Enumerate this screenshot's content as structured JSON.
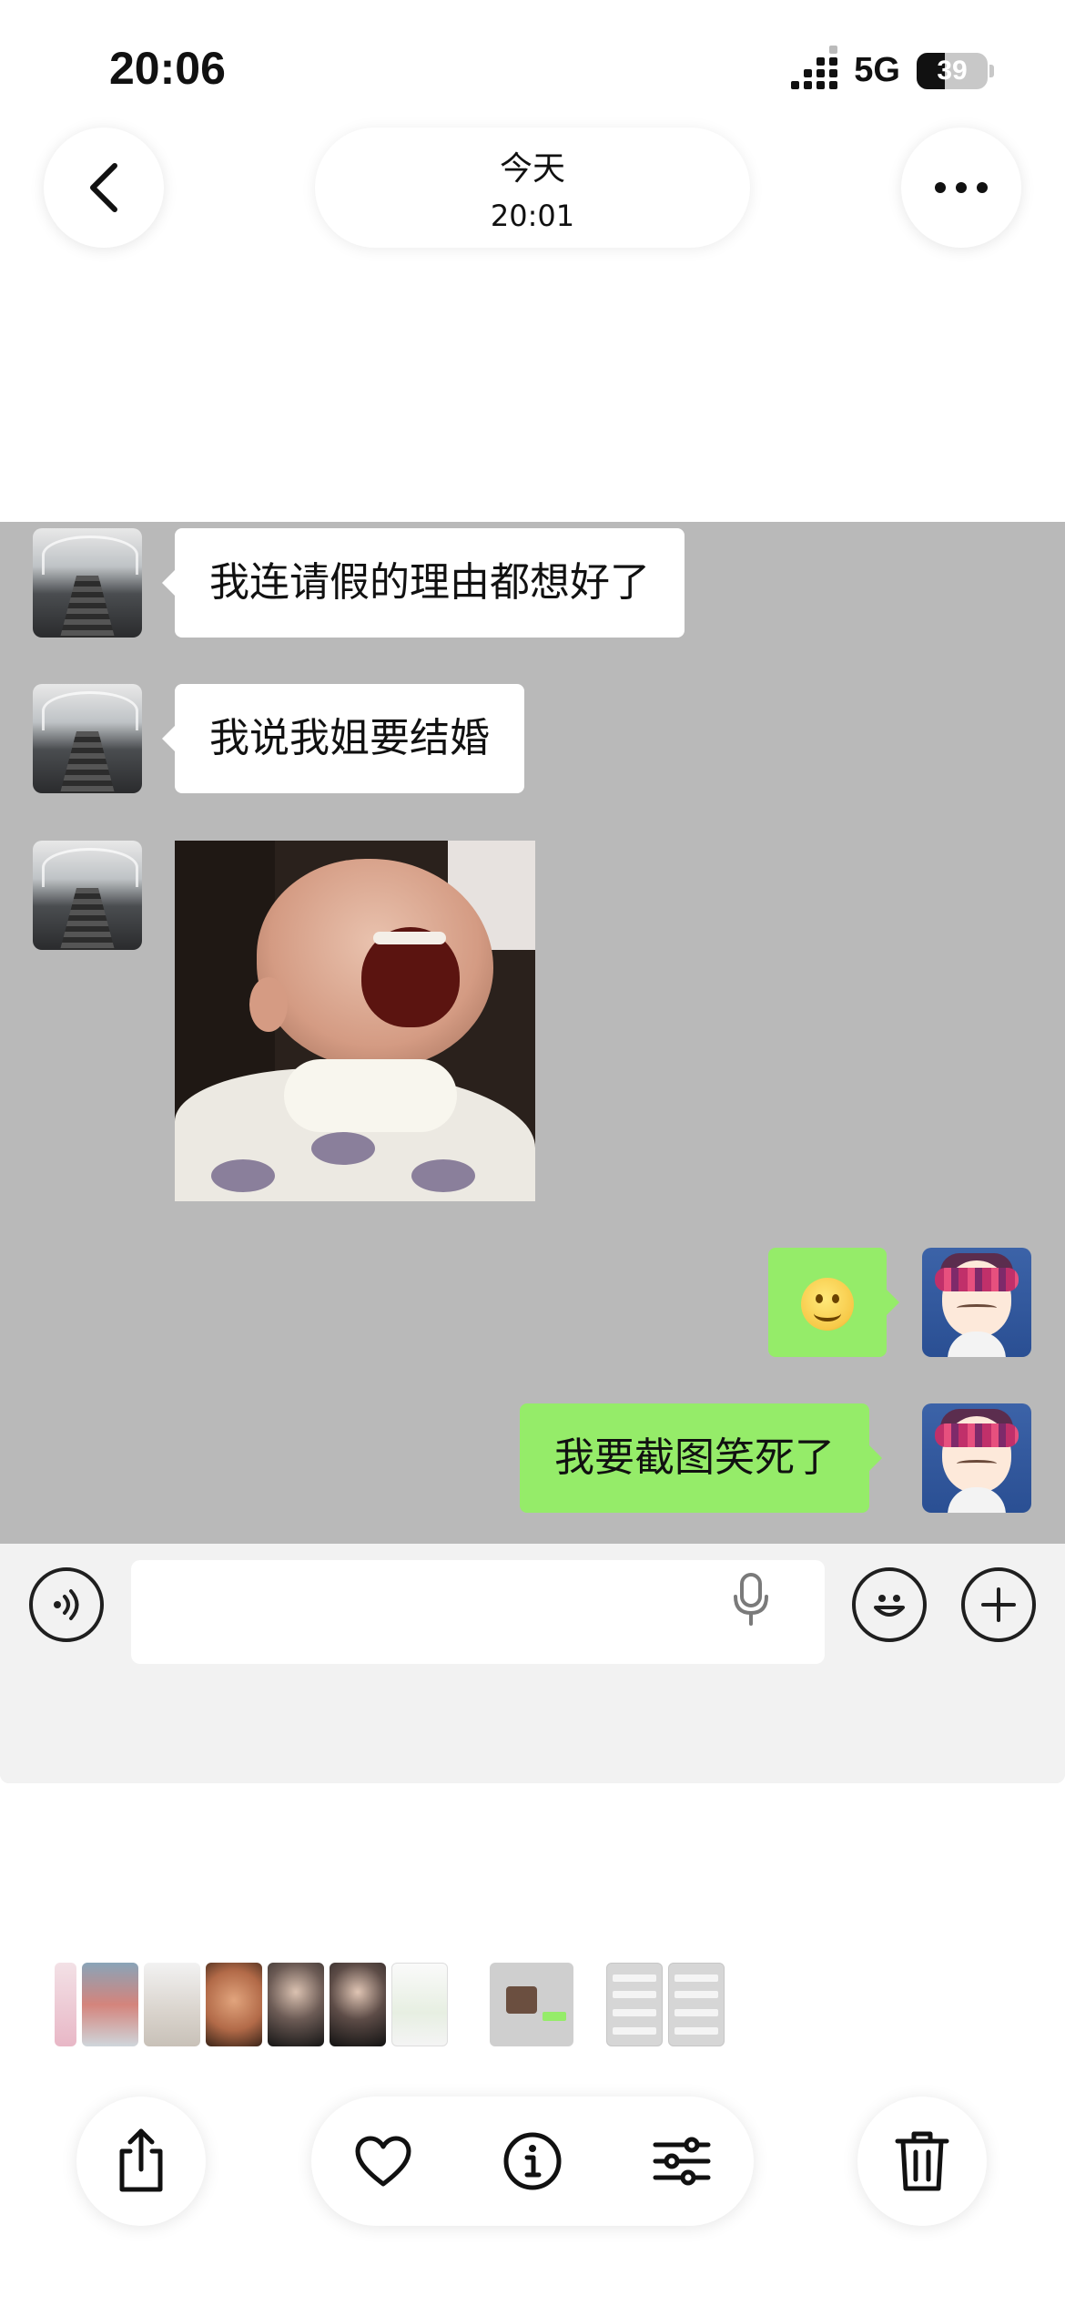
{
  "status_bar": {
    "time": "20:06",
    "network": "5G",
    "battery": "39"
  },
  "header": {
    "date_label": "今天",
    "time_label": "20:01"
  },
  "chat": {
    "messages": [
      {
        "side": "left",
        "type": "text",
        "text": "我连请假的理由都想好了"
      },
      {
        "side": "left",
        "type": "text",
        "text": "我说我姐要结婚"
      },
      {
        "side": "left",
        "type": "image"
      },
      {
        "side": "right",
        "type": "emoji",
        "emoji": "smiling-face"
      },
      {
        "side": "right",
        "type": "text",
        "text": "我要截图笑死了"
      }
    ]
  },
  "input_bar": {
    "voice_icon": "voice-wave-icon",
    "mic_icon": "microphone-icon",
    "emoji_icon": "smiley-icon",
    "plus_icon": "plus-icon"
  },
  "toolbar": {
    "icons": [
      "share-icon",
      "heart-icon",
      "info-icon",
      "adjust-icon",
      "trash-icon"
    ]
  },
  "colors": {
    "chat_background": "#b9b9b9",
    "outgoing_bubble": "#95ec69",
    "incoming_bubble": "#ffffff"
  }
}
